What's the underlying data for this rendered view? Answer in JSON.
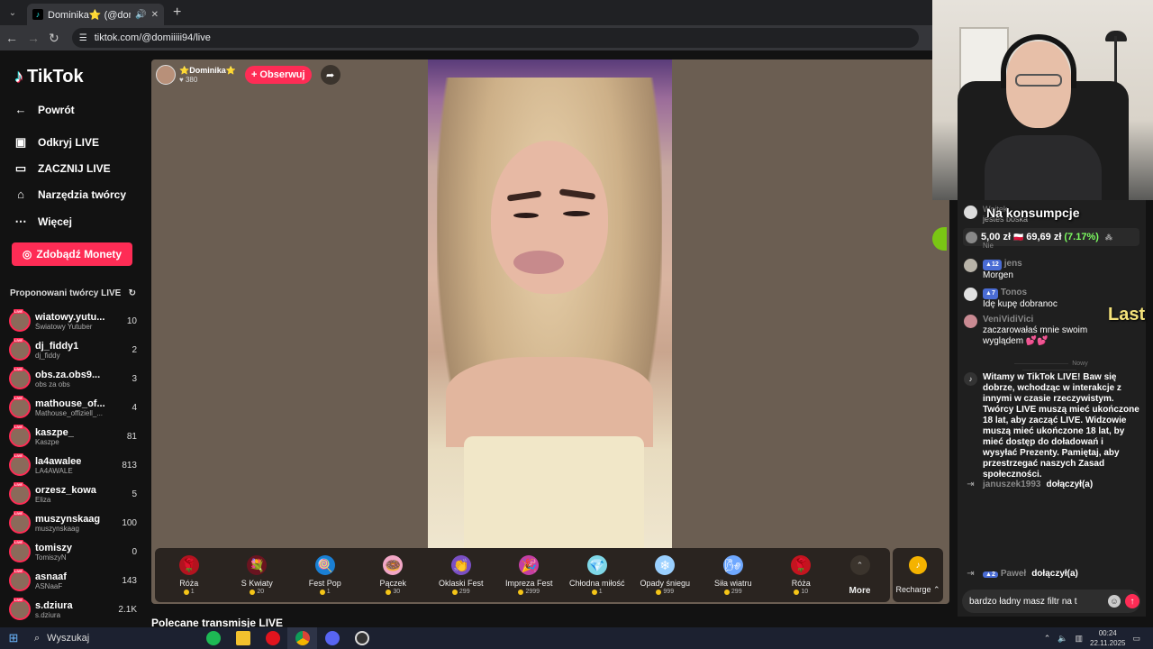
{
  "browser": {
    "tab_title": "Dominika⭐ (@domiii",
    "url": "tiktok.com/@domiiiii94/live"
  },
  "sidebar": {
    "logo": "TikTok",
    "nav": [
      {
        "label": "Powrót",
        "icon": "arrow-left-icon"
      },
      {
        "label": "Odkryj LIVE",
        "icon": "live-tv-icon"
      },
      {
        "label": "ZACZNIJ LIVE",
        "icon": "camera-icon"
      },
      {
        "label": "Narzędzia twórcy",
        "icon": "creator-tools-icon"
      },
      {
        "label": "Więcej",
        "icon": "more-dots-icon"
      }
    ],
    "coins_button": "Zdobądź Monety",
    "suggested_header": "Proponowani twórcy LIVE",
    "creators": [
      {
        "name": "wiatowy.yutu...",
        "sub": "Światowy Yutuber",
        "count": "10"
      },
      {
        "name": "dj_fiddy1",
        "sub": "dj_fiddy",
        "count": "2"
      },
      {
        "name": "obs.za.obs9...",
        "sub": "obs za obs",
        "count": "3"
      },
      {
        "name": "mathouse_of...",
        "sub": "Mathouse_offiziell_...",
        "count": "4"
      },
      {
        "name": "kaszpe_",
        "sub": "Kaszpe",
        "count": "81"
      },
      {
        "name": "la4awalee",
        "sub": "LA4AWALE",
        "count": "813"
      },
      {
        "name": "orzesz_kowa",
        "sub": "Eliza",
        "count": "5"
      },
      {
        "name": "muszynskaag",
        "sub": "muszynskaag",
        "count": "100"
      },
      {
        "name": "tomiszy",
        "sub": "TomiszyN",
        "count": "0"
      },
      {
        "name": "asnaaf",
        "sub": "ASNaaF",
        "count": "143"
      },
      {
        "name": "s.dziura",
        "sub": "s.dziura",
        "count": "2.1K"
      }
    ]
  },
  "stream": {
    "host_name": "Dominika",
    "host_likes": "380",
    "follow_label": "+ Obserwuj"
  },
  "gifts": [
    {
      "name": "Róża",
      "price": "1",
      "glyph": "🌹",
      "color": "#b3131f"
    },
    {
      "name": "S Kwiaty",
      "price": "20",
      "glyph": "💐",
      "color": "#6a1420"
    },
    {
      "name": "Fest Pop",
      "price": "1",
      "glyph": "🍭",
      "color": "#1a7fd4"
    },
    {
      "name": "Pączek",
      "price": "30",
      "glyph": "🍩",
      "color": "#f2a7c6"
    },
    {
      "name": "Oklaski Fest",
      "price": "299",
      "glyph": "👏",
      "color": "#7a4fc4"
    },
    {
      "name": "Impreza Fest",
      "price": "2999",
      "glyph": "🎉",
      "color": "#c43fa4"
    },
    {
      "name": "Chłodna miłość",
      "price": "1",
      "glyph": "💎",
      "color": "#7fd8e8"
    },
    {
      "name": "Opady śniegu",
      "price": "999",
      "glyph": "❄",
      "color": "#9ad0ff"
    },
    {
      "name": "Siła wiatru",
      "price": "299",
      "glyph": "🌬",
      "color": "#6fa8ff"
    },
    {
      "name": "Róża",
      "price": "10",
      "glyph": "🌹",
      "color": "#c4141f"
    }
  ],
  "more_label": "More",
  "recharge_label": "Recharge",
  "recommended_heading": "Polecane transmisje LIVE",
  "overlay": {
    "title": "Na konsumpcje",
    "ghost_user": "Wojtek",
    "ghost_text": "jesteś boska",
    "ghost_nie": "Nie",
    "ticker_value": "5,00 zł",
    "ticker_total": "69,69 zł",
    "ticker_pct": "(7.17%)",
    "last": "Last"
  },
  "chat": {
    "messages": [
      {
        "badge": "12",
        "user": "jens",
        "text": "Morgen"
      },
      {
        "badge": "7",
        "user": "Tonos",
        "text": "Idę kupę dobranoc"
      },
      {
        "badge": "",
        "user": "VeniVidiVici",
        "text": "zaczarowałaś mnie swoim wyglądem 💕💕"
      }
    ],
    "separator": "Nowy",
    "system": "Witamy w TikTok LIVE! Baw się dobrze, wchodząc w interakcje z innymi w czasie rzeczywistym. Twórcy LIVE muszą mieć ukończone 18 lat, aby zacząć LIVE. Widzowie muszą mieć ukończone 18 lat, by mieć dostęp do doładowań i wysyłać Prezenty. Pamiętaj, aby przestrzegać naszych Zasad społeczności.",
    "joined": [
      {
        "user": "januszek1993",
        "badge": "",
        "text": "dołączył(a)"
      },
      {
        "user": "Paweł",
        "badge": "2",
        "text": "dołączył(a)"
      }
    ],
    "input_value": "bardzo ładny masz filtr na t"
  },
  "taskbar": {
    "search": "Wyszukaj",
    "time": "00:24",
    "date": "22.11.2025"
  }
}
